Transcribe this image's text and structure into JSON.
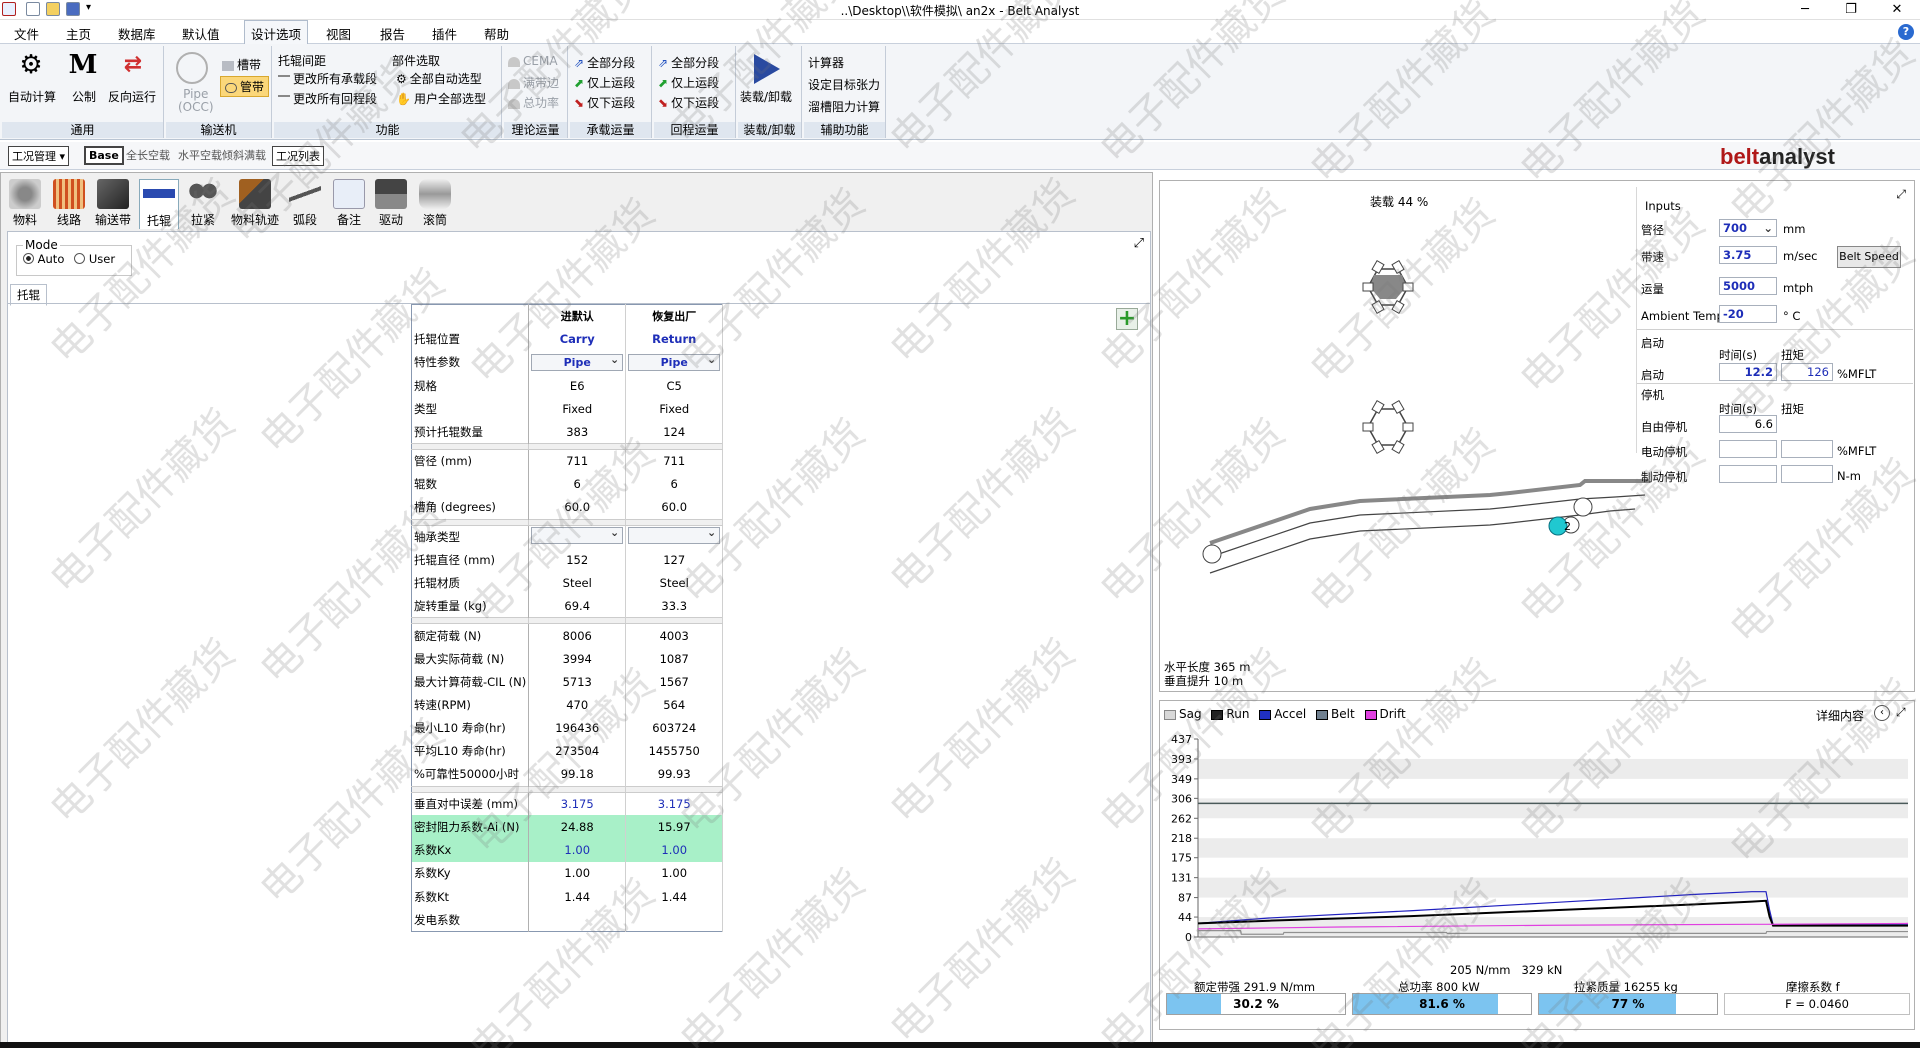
{
  "window": {
    "title": "..\\Desktop\\\\软件模拟\\     an2x - Belt Analyst",
    "minimize": "─",
    "restore": "❐",
    "close": "✕",
    "help": "?"
  },
  "menu": [
    "文件",
    "主页",
    "数据库",
    "默认值",
    "设计选项",
    "视图",
    "报告",
    "插件",
    "帮助"
  ],
  "ribbon": {
    "general": {
      "caption": "通用",
      "auto_calc": "自动计算",
      "control": "公制",
      "reverse": "反向运行"
    },
    "conveyor": {
      "caption": "输送机",
      "pipe": "Pipe\n(OCC)",
      "trough": "槽带",
      "pipe_belt": "管带"
    },
    "function": {
      "caption": "功能",
      "idler_spacing": "托辊间距",
      "part_selection": "部件选取",
      "change_carry": "更改所有承载段",
      "change_return": "更改所有回程段",
      "all_auto": "全部自动选型",
      "manual_all": "用户全部选型"
    },
    "theory": {
      "caption": "理论运量",
      "cema": "CEMA",
      "full_edge": "满带边",
      "total_power": "总功率"
    },
    "carry": {
      "caption": "承载运量",
      "all_seg": "全部分段",
      "only_up": "仅上运段",
      "only_down": "仅下运段"
    },
    "return": {
      "caption": "回程运量",
      "all_seg": "全部分段",
      "only_up": "仅上运段",
      "only_down": "仅下运段"
    },
    "loadunload": {
      "caption": "装载/卸载",
      "btn": "装载/卸载"
    },
    "aux": {
      "caption": "辅助功能",
      "calculator": "计算器",
      "set_tension": "设定目标张力",
      "trough_resist": "溜槽阻力计算"
    }
  },
  "toolbar": {
    "case_mgmt": "工况管理",
    "base": "Base",
    "full_empty": "全长空载",
    "horiz_empty": "水平空载倾斜满载",
    "case_list": "工况列表",
    "brand1": "belt",
    "brand2": "analyst"
  },
  "left_tabs": [
    "物料",
    "线路",
    "输送带",
    "托辊",
    "拉紧",
    "物料轨迹",
    "弧段",
    "备注",
    "驱动",
    "滚筒"
  ],
  "mode": {
    "title": "Mode",
    "auto": "Auto",
    "user": "User"
  },
  "subtab": "托辊",
  "table": {
    "headers": [
      "",
      "进默认",
      "恢复出厂"
    ],
    "rows": [
      {
        "label": "托辊位置",
        "carry": "Carry",
        "ret": "Return",
        "style": "bluebold"
      },
      {
        "label": "特性参数",
        "carry": "Pipe",
        "ret": "Pipe",
        "style": "dropdown"
      },
      {
        "label": "规格",
        "carry": "E6",
        "ret": "C5"
      },
      {
        "label": "类型",
        "carry": "Fixed",
        "ret": "Fixed"
      },
      {
        "label": "预计托辊数量",
        "carry": "383",
        "ret": "124"
      },
      {
        "sep": true
      },
      {
        "label": "管径 (mm)",
        "carry": "711",
        "ret": "711"
      },
      {
        "label": "辊数",
        "carry": "6",
        "ret": "6"
      },
      {
        "label": "槽角 (degrees)",
        "carry": "60.0",
        "ret": "60.0"
      },
      {
        "sep": true
      },
      {
        "label": "轴承类型",
        "carry": "",
        "ret": "",
        "style": "dropdown"
      },
      {
        "label": "托辊直径 (mm)",
        "carry": "152",
        "ret": "127"
      },
      {
        "label": "托辊材质",
        "carry": "Steel",
        "ret": "Steel"
      },
      {
        "label": "旋转重量 (kg)",
        "carry": "69.4",
        "ret": "33.3"
      },
      {
        "sep": true
      },
      {
        "label": "额定荷载 (N)",
        "carry": "8006",
        "ret": "4003"
      },
      {
        "label": "最大实际荷载 (N)",
        "carry": "3994",
        "ret": "1087"
      },
      {
        "label": "最大计算荷载-CIL (N)",
        "carry": "5713",
        "ret": "1567"
      },
      {
        "label": "转速(RPM)",
        "carry": "470",
        "ret": "564"
      },
      {
        "label": "最小L10 寿命(hr)",
        "carry": "196436",
        "ret": "603724"
      },
      {
        "label": "平均L10 寿命(hr)",
        "carry": "273504",
        "ret": "1455750"
      },
      {
        "label": "%可靠性50000小时",
        "carry": "99.18",
        "ret": "99.93"
      },
      {
        "sep": true
      },
      {
        "label": "垂直对中误差 (mm)",
        "carry": "3.175",
        "ret": "3.175",
        "style": "blue"
      },
      {
        "label": "密封阻力系数-Ai (N)",
        "carry": "24.88",
        "ret": "15.97",
        "style": "green"
      },
      {
        "label": "系数Kx",
        "carry": "1.00",
        "ret": "1.00",
        "style": "greenblue"
      },
      {
        "label": "系数Ky",
        "carry": "1.00",
        "ret": "1.00"
      },
      {
        "label": "系数Kt",
        "carry": "1.44",
        "ret": "1.44"
      },
      {
        "label": "发电系数",
        "carry": "",
        "ret": ""
      }
    ]
  },
  "profile": {
    "load_pct": "装载 44 %",
    "horiz_length": "水平长度 365 m",
    "vert_lift": "垂直提升  10  m",
    "pulley_label": "2"
  },
  "inputs": {
    "title": "Inputs",
    "pipe_dia_label": "管径",
    "pipe_dia": "700",
    "pipe_dia_unit": "mm",
    "speed_label": "带速",
    "speed": "3.75",
    "speed_unit": "m/sec",
    "belt_speed_btn": "Belt Speed",
    "capacity_label": "运量",
    "capacity": "5000",
    "capacity_unit": "mtph",
    "temp_label": "Ambient Temp",
    "temp": "-20",
    "temp_unit": "° C",
    "start_title": "启动",
    "time_hdr": "时间(s)",
    "torque_hdr": "扭矩",
    "start_label": "启动",
    "start_time": "12.2",
    "start_torque": "126",
    "mflt": "%MFLT",
    "stop_title": "停机",
    "stop_time_hdr": "时间(s)",
    "stop_torque_hdr": "扭矩",
    "free_stop": "自由停机",
    "free_stop_time": "6.6",
    "motor_stop": "电动停机",
    "motor_unit": "%MFLT",
    "brake_stop": "制动停机",
    "brake_unit": "N-m"
  },
  "legend": {
    "sag": "Sag",
    "run": "Run",
    "accel": "Accel",
    "belt": "Belt",
    "drift": "Drift",
    "side": "详细内容"
  },
  "chart_data": {
    "type": "line",
    "title": "",
    "xlabel": "",
    "ylabel": "",
    "yticks": [
      437,
      393,
      349,
      306,
      262,
      218,
      175,
      131,
      87,
      44,
      0
    ],
    "ylim": [
      0,
      437
    ],
    "xlim": [
      0,
      100
    ],
    "rated_line": {
      "name": "205 N/mm",
      "value": 295
    },
    "series": [
      {
        "name": "Accel",
        "color": "#2020c0",
        "x": [
          0,
          10,
          30,
          50,
          70,
          78,
          80,
          80.5,
          81,
          100
        ],
        "y": [
          30,
          42,
          58,
          76,
          94,
          100,
          100,
          60,
          27,
          27
        ]
      },
      {
        "name": "Run",
        "color": "#000000",
        "x": [
          0,
          10,
          30,
          50,
          70,
          78,
          80,
          80.5,
          81,
          100
        ],
        "y": [
          30,
          36,
          46,
          59,
          72,
          78,
          80,
          45,
          25,
          25
        ]
      },
      {
        "name": "Drift",
        "color": "#e040e0",
        "x": [
          0,
          20,
          50,
          78,
          80,
          100
        ],
        "y": [
          18,
          22,
          26,
          28,
          28,
          30
        ]
      },
      {
        "name": "Sag",
        "color": "#909090",
        "x": [
          0,
          6,
          6.1,
          12,
          12.1,
          35,
          35.1,
          80,
          80.1,
          100
        ],
        "y": [
          14,
          14,
          6,
          6,
          10,
          10,
          8,
          8,
          12,
          12
        ]
      }
    ]
  },
  "bottom": {
    "note_tension": "205 N/mm",
    "note_kn": "329 kN",
    "rated_label": "额定带强 291.9 N/mm",
    "rated_pct": "30.2 %",
    "rated_val": 0.302,
    "power_label": "总功率 800 kW",
    "power_pct": "81.6 %",
    "power_val": 0.816,
    "take_label": "拉紧质量 16255 kg",
    "take_pct": "77 %",
    "take_val": 0.77,
    "friction_label": "摩擦系数 f",
    "friction": "F = 0.0460"
  },
  "watermark": "电子配件藏货"
}
